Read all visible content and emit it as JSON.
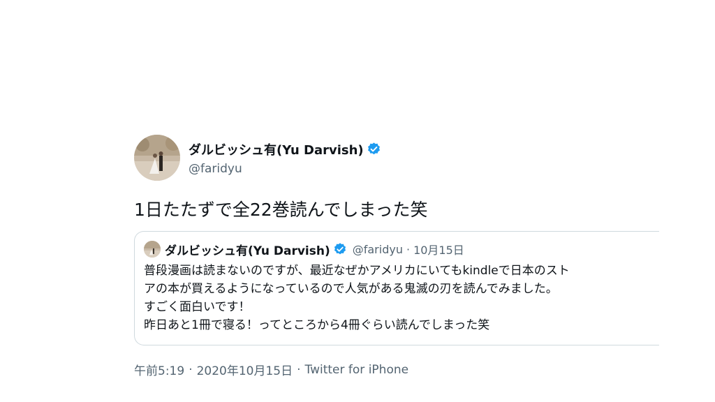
{
  "author": {
    "display_name": "ダルビッシュ有(Yu Darvish)",
    "handle": "@faridyu",
    "avatar_icon": "wedding-photo-avatar",
    "verified_icon": "verified-badge-icon",
    "verified_color": "#1d9bf0"
  },
  "tweet": {
    "text": "1日たたずで全22巻読んでしまった笑"
  },
  "quoted_tweet": {
    "display_name": "ダルビッシュ有(Yu Darvish)",
    "handle": "@faridyu",
    "separator": "·",
    "date": "10月15日",
    "lines": [
      "普段漫画は読まないのですが、最近なぜかアメリカにいてもkindleで日本のスト",
      "アの本が買えるようになっているので人気がある鬼滅の刃を読んでみました。",
      "すごく面白いです！",
      "昨日あと1冊で寝る！ってところから4冊ぐらい読んでしまった笑"
    ]
  },
  "meta": {
    "time": "午前5:19",
    "separator": "·",
    "date": "2020年10月15日",
    "source": "Twitter for iPhone"
  },
  "colors": {
    "text": "#0f1419",
    "secondary": "#536471",
    "border": "#cfd9de",
    "verified": "#1d9bf0"
  }
}
